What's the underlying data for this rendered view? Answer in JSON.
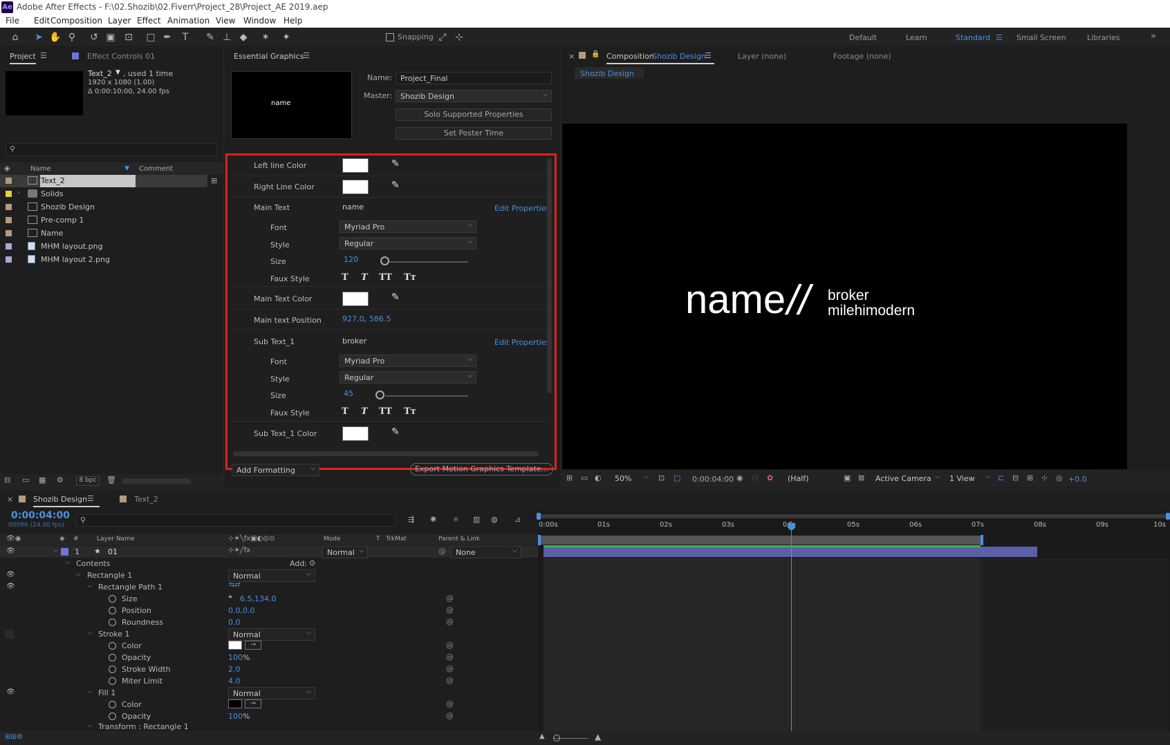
{
  "app": {
    "title": "Adobe After Effects - F:\\02.Shozib\\02.Fiverr\\Project_28\\Project_AE 2019.aep",
    "logo": "Ae"
  },
  "menu": [
    "File",
    "Edit",
    "Composition",
    "Layer",
    "Effect",
    "Animation",
    "View",
    "Window",
    "Help"
  ],
  "toolbar": {
    "snapping": "Snapping",
    "workspaces": [
      "Default",
      "Learn",
      "Standard",
      "Small Screen",
      "Libraries"
    ],
    "active_workspace": "Standard",
    "more": "»"
  },
  "project": {
    "tab": "Project",
    "effect_tab": "Effect Controls 01",
    "selected_name": "Text_2",
    "used": ", used 1 time",
    "dims": "1920 x 1080 (1.00)",
    "duration": "Δ 0:00:10:00, 24.00 fps",
    "col_name": "Name",
    "col_comment": "Comment",
    "items": [
      {
        "name": "Text_2",
        "color": "#b59b7c",
        "icon": "composition-icon"
      },
      {
        "name": "Solids",
        "color": "#e6d23c",
        "icon": "folder-icon"
      },
      {
        "name": "Shozib Design",
        "color": "#b59b7c",
        "icon": "composition-icon"
      },
      {
        "name": "Pre-comp 1",
        "color": "#b59b7c",
        "icon": "composition-icon"
      },
      {
        "name": "Name",
        "color": "#b59b7c",
        "icon": "composition-icon"
      },
      {
        "name": "MHM layout.png",
        "color": "#a9a9d8",
        "icon": "image-file-icon"
      },
      {
        "name": "MHM layout 2.png",
        "color": "#a9a9d8",
        "icon": "image-file-icon"
      }
    ],
    "bpc": "8 bpc"
  },
  "eg": {
    "tab": "Essential Graphics",
    "name_label": "Name:",
    "name_value": "Project_Final",
    "master_label": "Master:",
    "master_value": "Shozib Design",
    "solo_btn": "Solo Supported Properties",
    "poster_btn": "Set Poster Time",
    "thumb_text": "name",
    "props": {
      "left_line": "Left line Color",
      "right_line": "Right Line Color",
      "main_text": "Main Text",
      "main_text_value": "name",
      "edit1": "Edit Properties",
      "font": "Font",
      "font_value": "Myriad Pro",
      "style": "Style",
      "style_value": "Regular",
      "size": "Size",
      "size_value": "120",
      "faux": "Faux Style",
      "faux_glyphs": [
        "T",
        "T",
        "TT",
        "Tт"
      ],
      "main_color": "Main Text Color",
      "main_pos": "Main text Position",
      "main_pos_x": "927.0",
      "main_pos_sep": ",",
      "main_pos_y": "586.5",
      "sub_text": "Sub Text_1",
      "sub_text_value": "broker",
      "edit2": "Edit Properties",
      "font2": "Font",
      "font2_value": "Myriad Pro",
      "style2": "Style",
      "style2_value": "Regular",
      "size2": "Size",
      "size2_value": "45",
      "faux2": "Faux Style",
      "sub_color": "Sub Text_1 Color"
    },
    "add_formatting": "Add Formatting",
    "export_btn": "Export Motion Graphics Template..."
  },
  "comp": {
    "tab_prefix": "Composition",
    "tab_name": "Shozib Design",
    "layer_tab": "Layer (none)",
    "footage_tab": "Footage (none)",
    "subtab": "Shozib Design",
    "main_text": "name",
    "slash": "//",
    "sub1": "broker",
    "sub2": "milehimodern",
    "zoom": "50%",
    "time": "0:00:04:00",
    "res": "(Half)",
    "camera": "Active Camera",
    "view": "1 View",
    "exposure": "+0.0"
  },
  "timeline": {
    "tab": "Shozib Design",
    "tab2": "Text_2",
    "timecode": "0:00:04:00",
    "frames": "00096 (24.00 fps)",
    "col_layer": "Layer Name",
    "col_num": "#",
    "col_mode": "Mode",
    "col_t": "T",
    "col_trkmat": "TrkMat",
    "col_parent": "Parent & Link",
    "layer_num": "1",
    "layer_name": "01",
    "layer_mode": "Normal",
    "layer_parent": "None",
    "add_label": "Add:",
    "ruler": [
      "0:00s",
      "01s",
      "02s",
      "03s",
      "04s",
      "05s",
      "06s",
      "07s",
      "08s",
      "09s",
      "10s"
    ],
    "playhead_fraction": 0.4,
    "work_area_end_fraction": 0.7,
    "bar_end_fraction": 0.79,
    "rows": {
      "contents": "Contents",
      "rect1": "Rectangle 1",
      "rect1_mode": "Normal",
      "rectpath": "Rectangle Path 1",
      "size": "Size",
      "size_val": "6.5,134.0",
      "position": "Position",
      "position_val": "0.0,0.0",
      "roundness": "Roundness",
      "roundness_val": "0.0",
      "stroke": "Stroke 1",
      "stroke_mode": "Normal",
      "color": "Color",
      "opacity": "Opacity",
      "opacity_val": "100",
      "pct": "%",
      "stroke_w": "Stroke Width",
      "stroke_w_val": "2.0",
      "miter": "Miter Limit",
      "miter_val": "4.0",
      "fill": "Fill 1",
      "fill_mode": "Normal",
      "fill_color": "Color",
      "fill_opacity": "Opacity",
      "fill_opacity_val": "100",
      "fill_pct": "%",
      "transform": "Transform : Rectangle 1"
    }
  }
}
